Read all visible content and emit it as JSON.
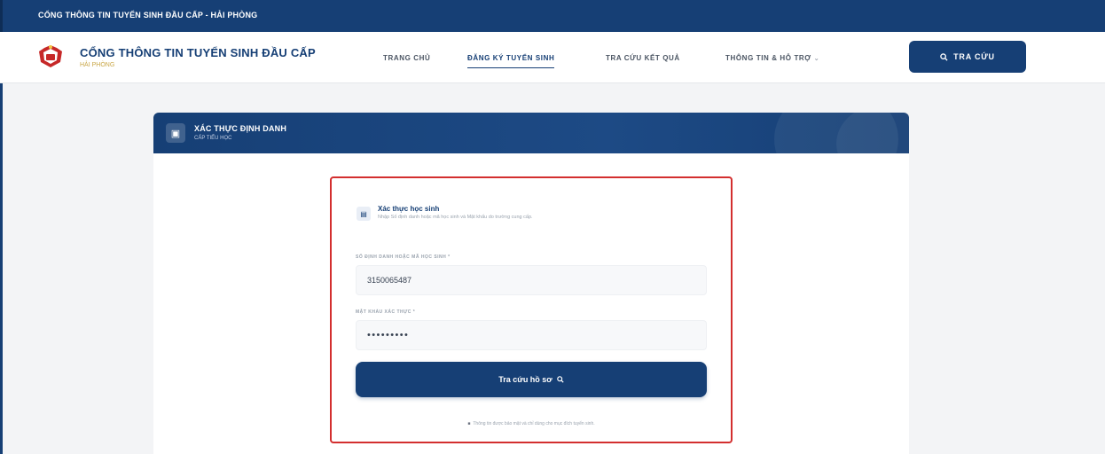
{
  "topbar": {
    "text": "CỔNG THÔNG TIN TUYỂN SINH ĐẦU CẤP - HẢI PHÒNG"
  },
  "header": {
    "brand_title": "CỔNG THÔNG TIN TUYỂN SINH ĐẦU CẤP",
    "brand_sub": "HẢI PHÒNG",
    "nav": [
      {
        "label": "TRANG CHỦ"
      },
      {
        "label": "ĐĂNG KÝ TUYỂN SINH",
        "active": true
      },
      {
        "label": "TRA CỨU KẾT QUẢ"
      },
      {
        "label": "THÔNG TIN & HỖ TRỢ"
      }
    ],
    "search_button": "TRA CỨU"
  },
  "card": {
    "title": "XÁC THỰC ĐỊNH DANH",
    "subtitle": "CẤP TIỂU HỌC"
  },
  "verify": {
    "title": "Xác thực học sinh",
    "description": "Nhập Số định danh hoặc mã học sinh và Mật khẩu do trường cung cấp."
  },
  "form": {
    "id_label": "SỐ ĐỊNH DANH HOẶC MÃ HỌC SINH *",
    "id_value": "3150065487",
    "pw_label": "MẬT KHẨU XÁC THỰC *",
    "pw_value": "•••••••••",
    "submit_label": "Tra cứu hồ sơ"
  },
  "note": "Thông tin được bảo mật và chỉ dùng cho mục đích tuyển sinh.",
  "colors": {
    "primary": "#163f75",
    "highlight": "#d32f2f",
    "gold": "#c9a646"
  },
  "icons": [
    "logo-icon",
    "search-icon",
    "id-card-icon",
    "student-card-icon",
    "lock-icon",
    "chevron-down-icon"
  ]
}
